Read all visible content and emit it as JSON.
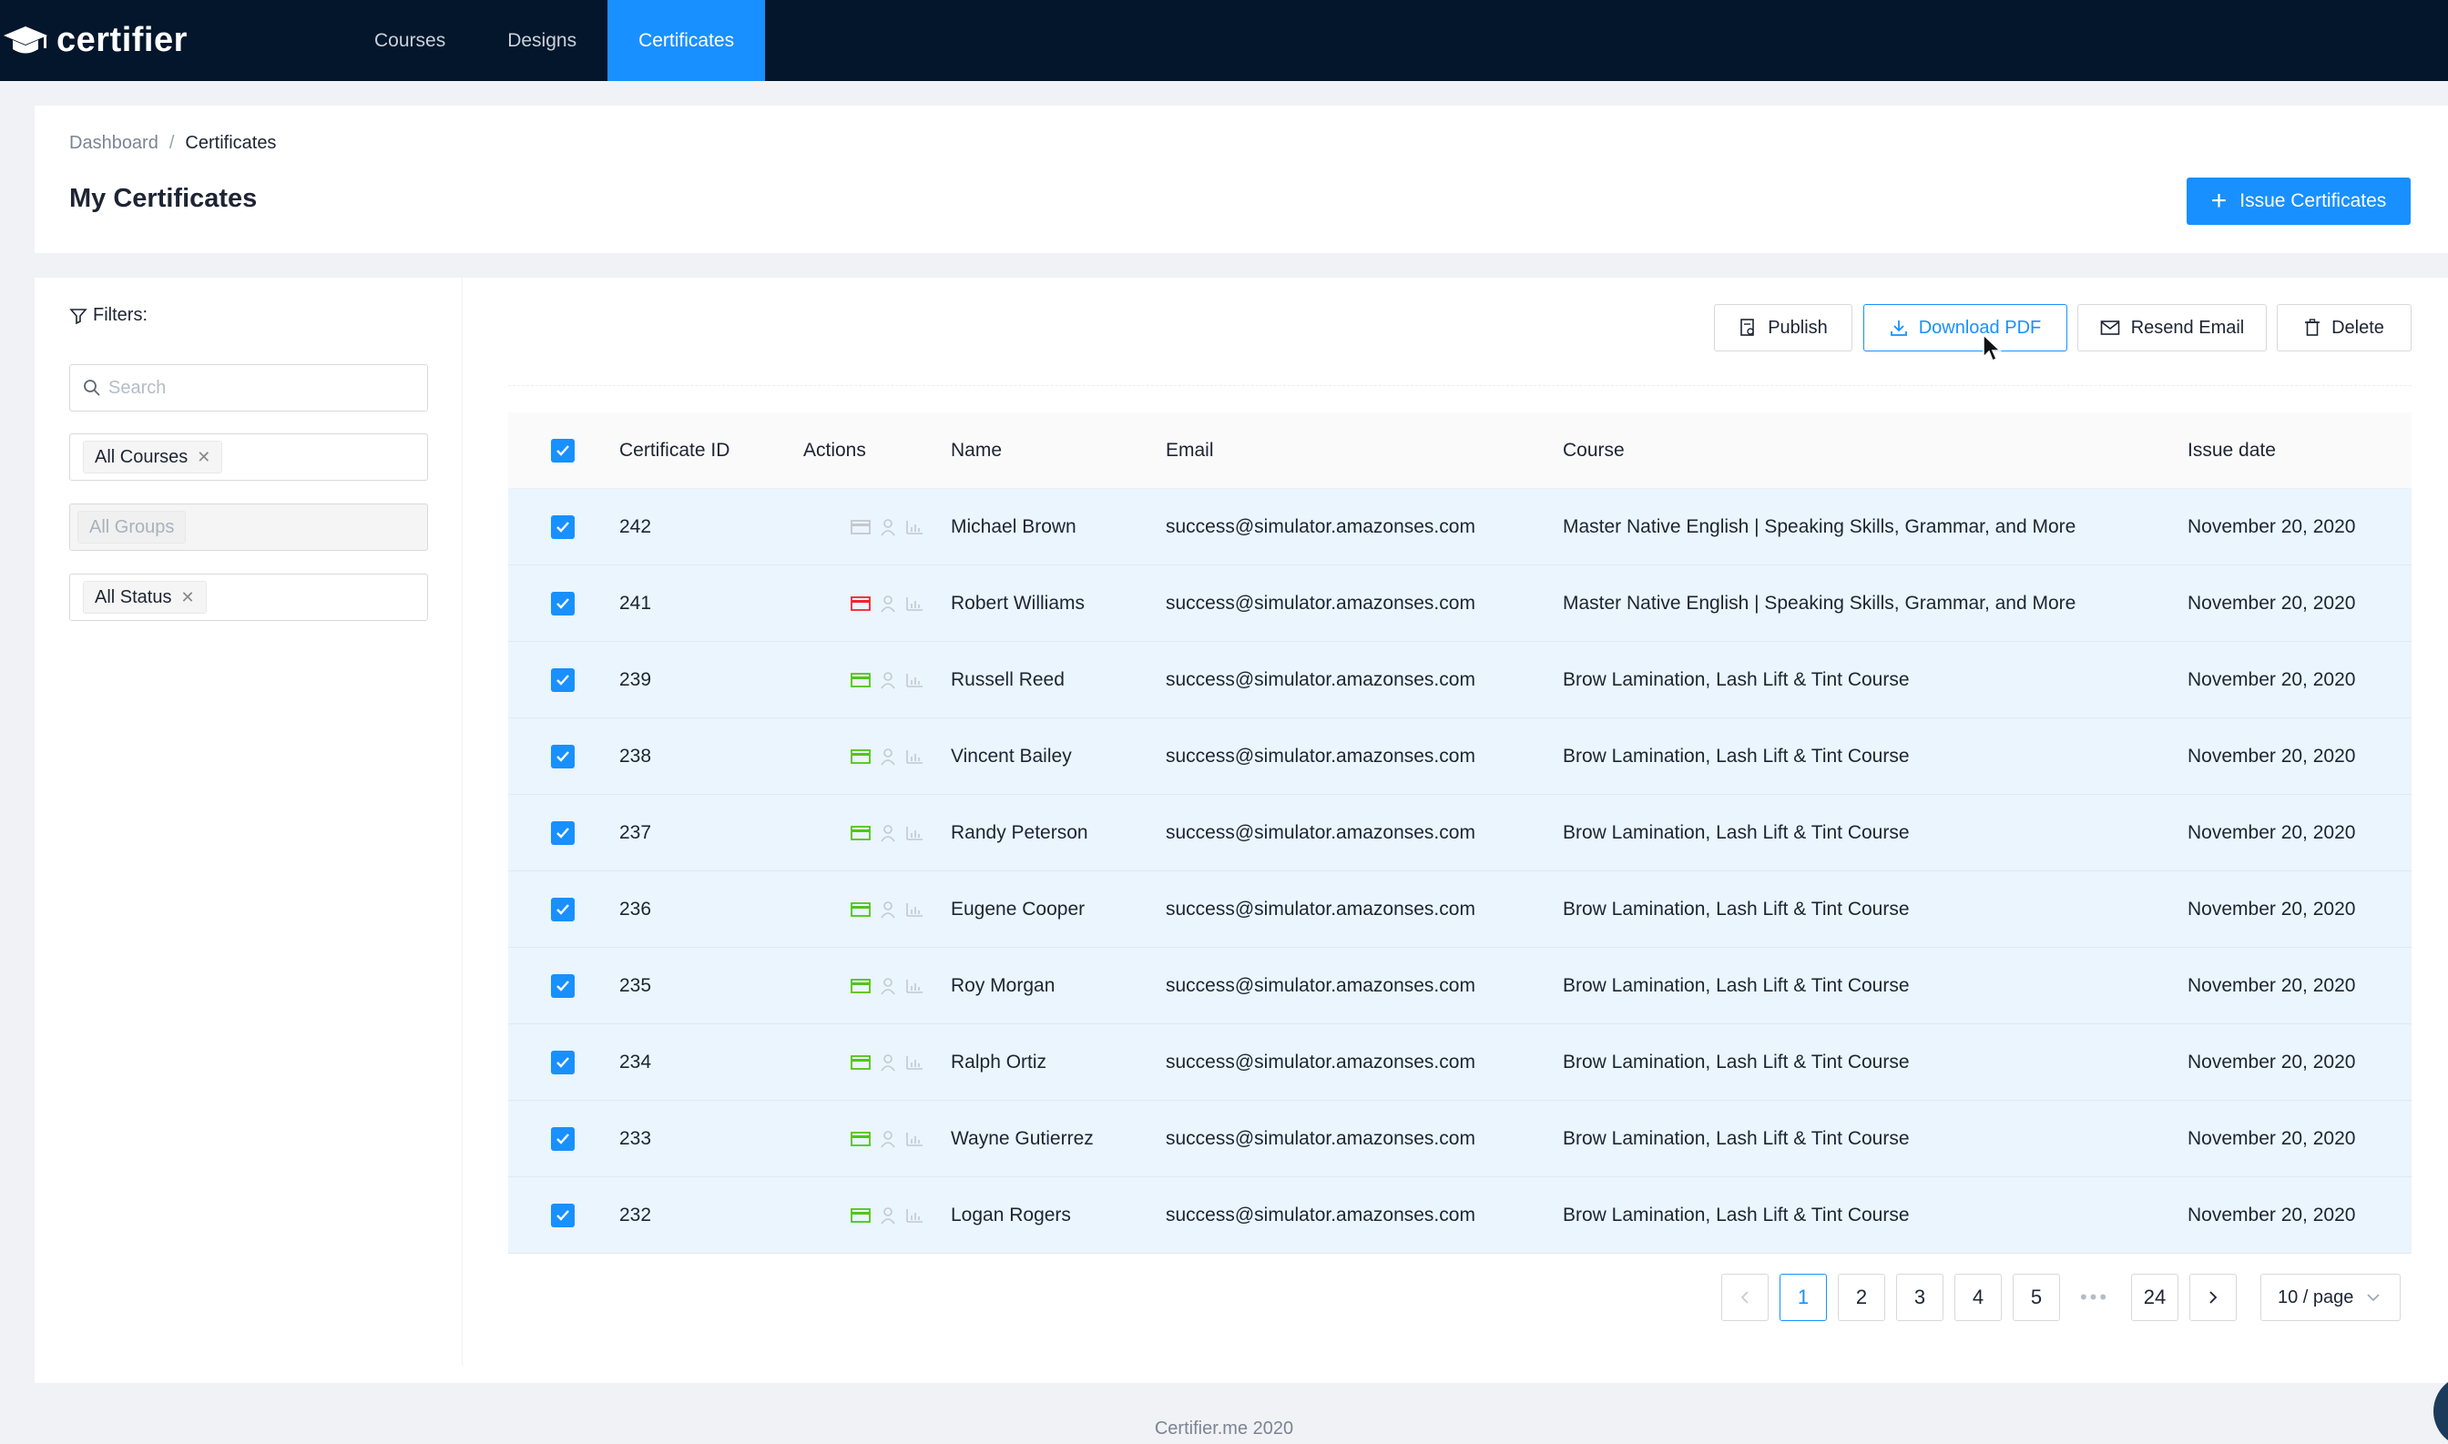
{
  "app": {
    "logo_text": "certifier",
    "nav": [
      {
        "label": "Courses",
        "active": false
      },
      {
        "label": "Designs",
        "active": false
      },
      {
        "label": "Certificates",
        "active": true
      }
    ]
  },
  "header": {
    "breadcrumb": [
      "Dashboard",
      "Certificates"
    ],
    "breadcrumb_sep": "/",
    "title": "My Certificates",
    "issue_button": "Issue Certificates"
  },
  "filters": {
    "title": "Filters:",
    "search_placeholder": "Search",
    "courses_tag": "All Courses",
    "groups_tag": "All Groups",
    "status_tag": "All Status"
  },
  "toolbar": {
    "publish": "Publish",
    "download_pdf": "Download PDF",
    "resend_email": "Resend Email",
    "delete": "Delete"
  },
  "table": {
    "columns": [
      "Certificate ID",
      "Actions",
      "Name",
      "Email",
      "Course",
      "Issue date"
    ],
    "rows": [
      {
        "id": "242",
        "name": "Michael Brown",
        "email": "success@simulator.amazonses.com",
        "course": "Master Native English | Speaking Skills, Grammar, and More",
        "date": "November 20, 2020",
        "card_status": "grey"
      },
      {
        "id": "241",
        "name": "Robert Williams",
        "email": "success@simulator.amazonses.com",
        "course": "Master Native English | Speaking Skills, Grammar, and More",
        "date": "November 20, 2020",
        "card_status": "red"
      },
      {
        "id": "239",
        "name": "Russell Reed",
        "email": "success@simulator.amazonses.com",
        "course": "Brow Lamination, Lash Lift & Tint Course",
        "date": "November 20, 2020",
        "card_status": "green"
      },
      {
        "id": "238",
        "name": "Vincent Bailey",
        "email": "success@simulator.amazonses.com",
        "course": "Brow Lamination, Lash Lift & Tint Course",
        "date": "November 20, 2020",
        "card_status": "green"
      },
      {
        "id": "237",
        "name": "Randy Peterson",
        "email": "success@simulator.amazonses.com",
        "course": "Brow Lamination, Lash Lift & Tint Course",
        "date": "November 20, 2020",
        "card_status": "green"
      },
      {
        "id": "236",
        "name": "Eugene Cooper",
        "email": "success@simulator.amazonses.com",
        "course": "Brow Lamination, Lash Lift & Tint Course",
        "date": "November 20, 2020",
        "card_status": "green"
      },
      {
        "id": "235",
        "name": "Roy Morgan",
        "email": "success@simulator.amazonses.com",
        "course": "Brow Lamination, Lash Lift & Tint Course",
        "date": "November 20, 2020",
        "card_status": "green"
      },
      {
        "id": "234",
        "name": "Ralph Ortiz",
        "email": "success@simulator.amazonses.com",
        "course": "Brow Lamination, Lash Lift & Tint Course",
        "date": "November 20, 2020",
        "card_status": "green"
      },
      {
        "id": "233",
        "name": "Wayne Gutierrez",
        "email": "success@simulator.amazonses.com",
        "course": "Brow Lamination, Lash Lift & Tint Course",
        "date": "November 20, 2020",
        "card_status": "green"
      },
      {
        "id": "232",
        "name": "Logan Rogers",
        "email": "success@simulator.amazonses.com",
        "course": "Brow Lamination, Lash Lift & Tint Course",
        "date": "November 20, 2020",
        "card_status": "green"
      }
    ]
  },
  "pagination": {
    "pages": [
      "1",
      "2",
      "3",
      "4",
      "5"
    ],
    "ellipsis": "•••",
    "last_page": "24",
    "current": "1",
    "page_size": "10 / page"
  },
  "footer": "Certifier.me 2020",
  "colors": {
    "accent": "#1890ff",
    "nav_bg": "#03162b",
    "status_green": "#52c41a",
    "status_red": "#f5222d",
    "status_grey": "#c3c8cf"
  }
}
